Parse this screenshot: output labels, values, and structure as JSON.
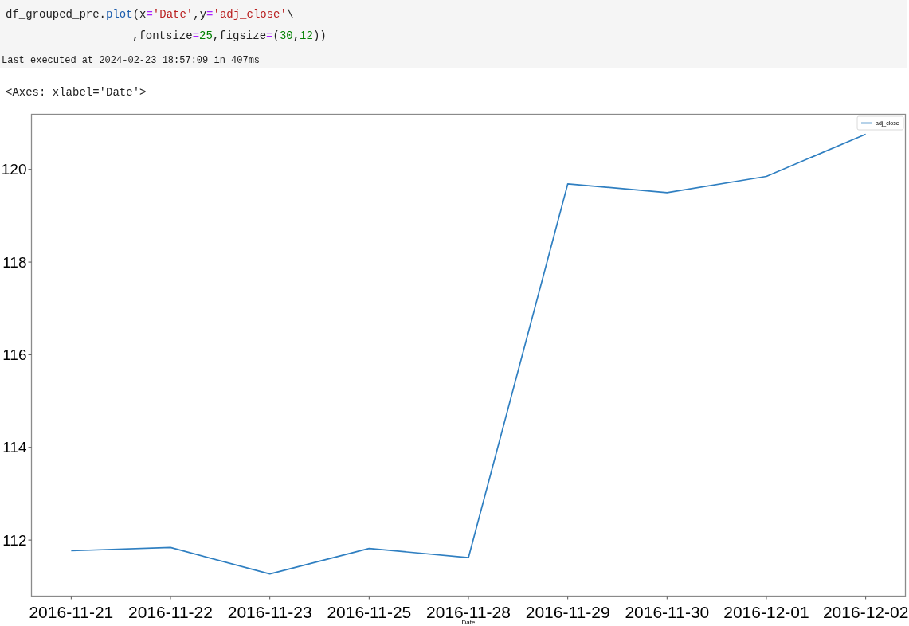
{
  "cell": {
    "code_lines": [
      {
        "kind": "first",
        "tokens": [
          {
            "kind": "name",
            "text": "df_grouped_pre."
          },
          {
            "kind": "func",
            "text": "plot"
          },
          {
            "kind": "name",
            "text": "(x"
          },
          {
            "kind": "op",
            "text": "="
          },
          {
            "kind": "string",
            "text": "'Date'"
          },
          {
            "kind": "name",
            "text": ",y"
          },
          {
            "kind": "op",
            "text": "="
          },
          {
            "kind": "string",
            "text": "'adj_close'"
          },
          {
            "kind": "name",
            "text": "\\"
          }
        ]
      },
      {
        "kind": "continuation",
        "tokens": [
          {
            "kind": "name",
            "text": ",fontsize"
          },
          {
            "kind": "op",
            "text": "="
          },
          {
            "kind": "number",
            "text": "25"
          },
          {
            "kind": "name",
            "text": ",figsize"
          },
          {
            "kind": "op",
            "text": "="
          },
          {
            "kind": "name",
            "text": "("
          },
          {
            "kind": "number",
            "text": "30"
          },
          {
            "kind": "name",
            "text": ","
          },
          {
            "kind": "number",
            "text": "12"
          },
          {
            "kind": "name",
            "text": "))"
          }
        ]
      }
    ],
    "status": "Last executed at 2024-02-23 18:57:09 in 407ms"
  },
  "output": {
    "repr": "<Axes: xlabel='Date'>",
    "chart_data": {
      "type": "line",
      "xlabel": "Date",
      "categories": [
        "2016-11-21",
        "2016-11-22",
        "2016-11-23",
        "2016-11-25",
        "2016-11-28",
        "2016-11-29",
        "2016-11-30",
        "2016-12-01",
        "2016-12-02"
      ],
      "series": [
        {
          "name": "adj_close",
          "color": "#2f7fc1",
          "values": [
            111.77,
            111.84,
            111.27,
            111.82,
            111.62,
            119.69,
            119.5,
            119.85,
            120.76
          ]
        }
      ],
      "ylim": [
        110.79,
        121.19
      ],
      "yticks": [
        112,
        114,
        116,
        118,
        120
      ]
    }
  }
}
